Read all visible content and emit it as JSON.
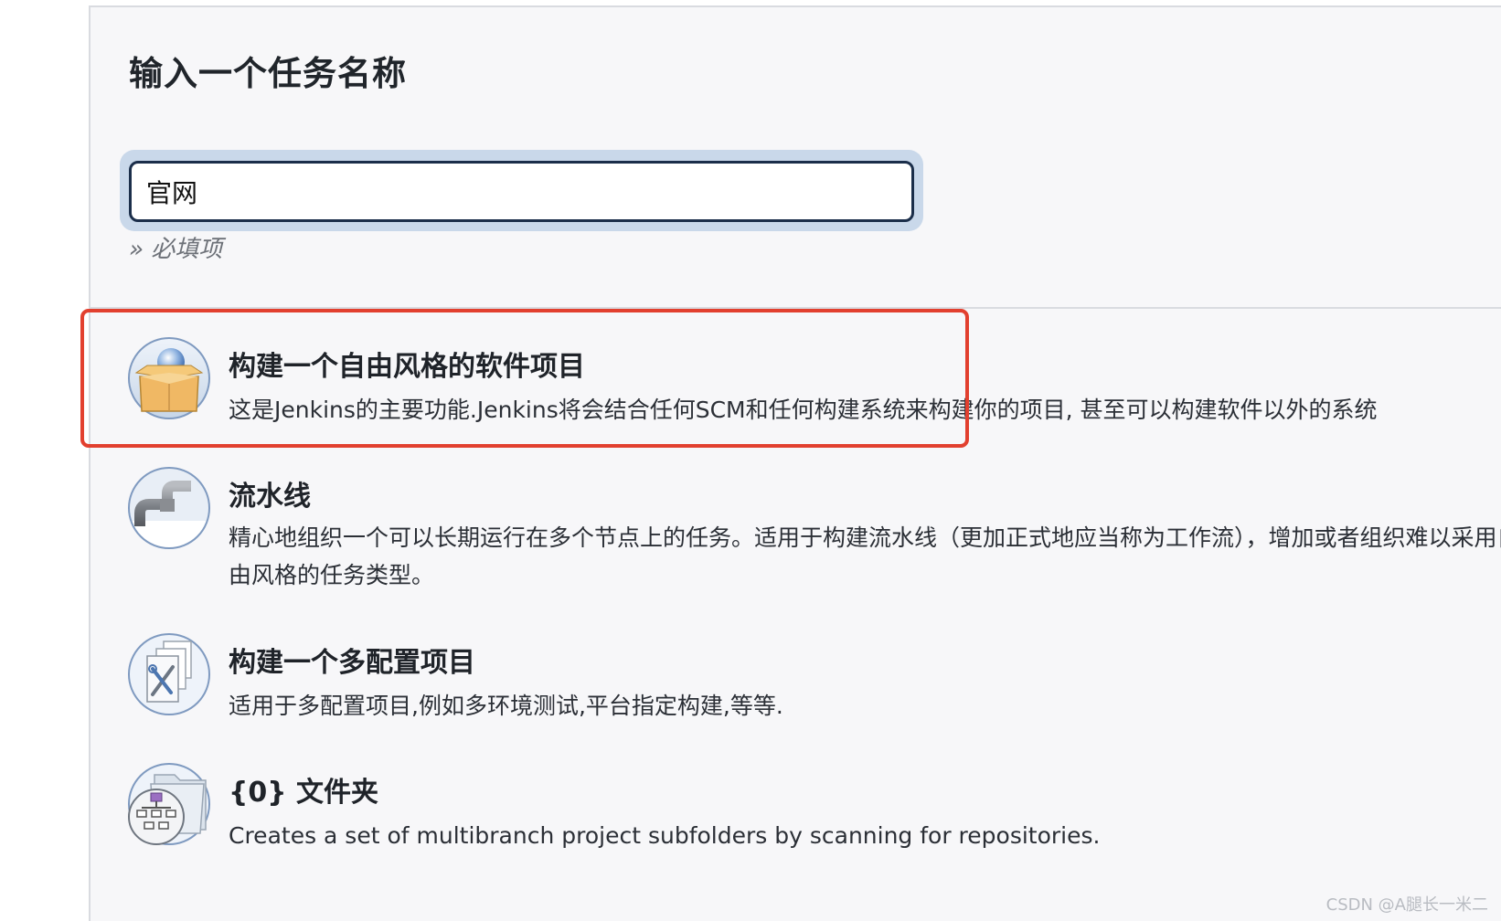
{
  "form": {
    "title": "输入一个任务名称",
    "name_value": "官网",
    "required_hint": "» 必填项"
  },
  "job_types": [
    {
      "title": "构建一个自由风格的软件项目",
      "description": "这是Jenkins的主要功能.Jenkins将会结合任何SCM和任何构建系统来构建你的项目, 甚至可以构建软件以外的系统",
      "icon": "freestyle-box-icon",
      "highlighted": true
    },
    {
      "title": "流水线",
      "description": "精心地组织一个可以长期运行在多个节点上的任务。适用于构建流水线（更加正式地应当称为工作流），增加或者组织难以采用自由风格的任务类型。",
      "icon": "pipeline-pipe-icon"
    },
    {
      "title": "构建一个多配置项目",
      "description": "适用于多配置项目,例如多环境测试,平台指定构建,等等.",
      "icon": "multi-config-icon"
    },
    {
      "title": "{0} 文件夹",
      "description": "Creates a set of multibranch project subfolders by scanning for repositories.",
      "icon": "org-folder-icon"
    }
  ],
  "colors": {
    "highlight_border": "#e2402f",
    "input_border": "#1b2e4a",
    "panel_bg": "#f7f7f9"
  },
  "watermark": "CSDN @A腿长一米二"
}
